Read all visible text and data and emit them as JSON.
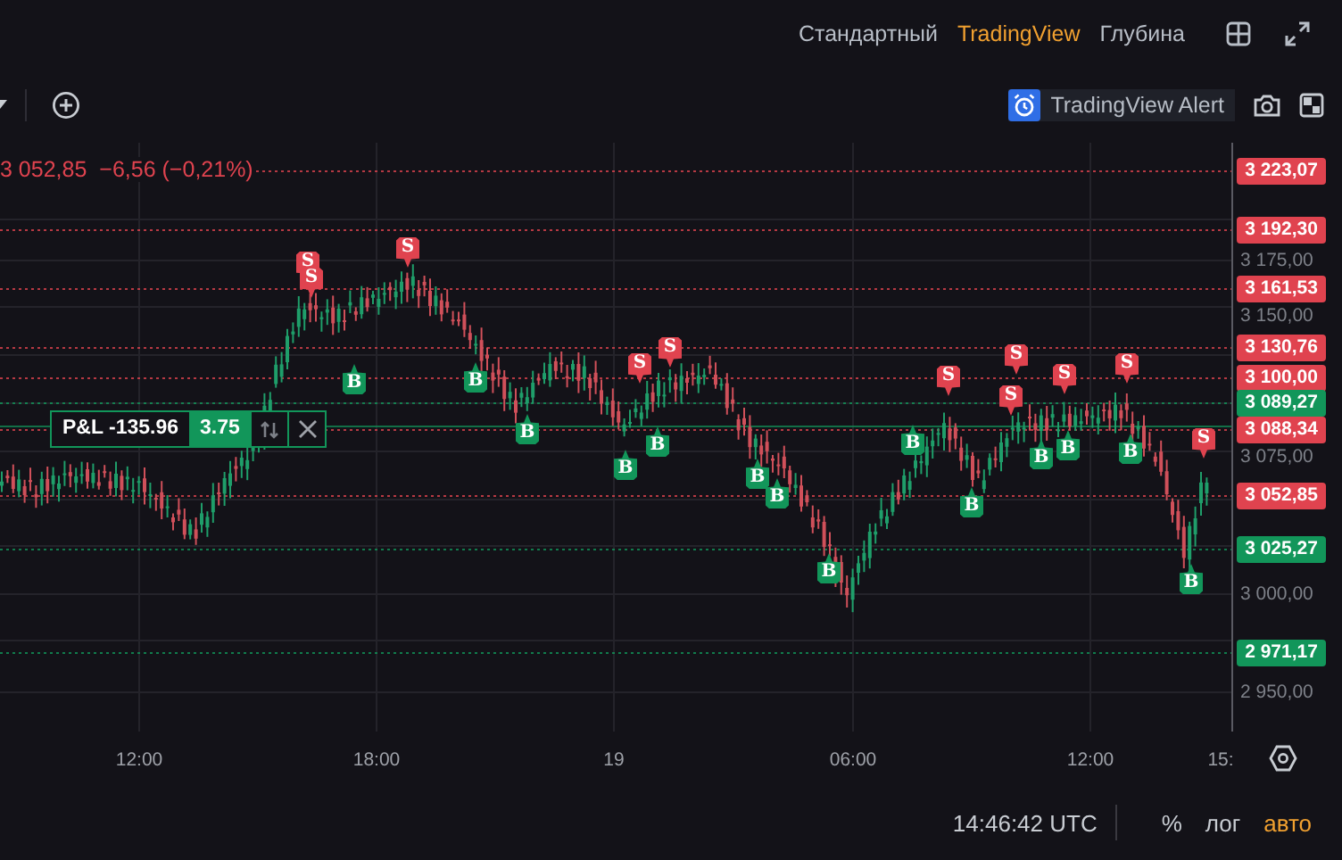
{
  "chart_types": [
    {
      "label": "Стандартный",
      "selected": false
    },
    {
      "label": "TradingView",
      "selected": true
    },
    {
      "label": "Глубина",
      "selected": false
    }
  ],
  "toolbar": {
    "alert_button": "TradingView Alert"
  },
  "legend": {
    "price": "3 052,85",
    "change": "−6,56 (−0,21%)"
  },
  "price_axis": {
    "ticks": [
      "3 175,00",
      "3 150,00",
      "3 075,00",
      "3 000,00",
      "2 950,00"
    ],
    "price_lines": [
      {
        "label": "3 223,07",
        "color": "#e0434f"
      },
      {
        "label": "3 192,30",
        "color": "#e0434f"
      },
      {
        "label": "3 161,53",
        "color": "#e0434f"
      },
      {
        "label": "3 130,76",
        "color": "#e0434f"
      },
      {
        "label": "3 100,00",
        "color": "#e0434f"
      },
      {
        "label": "3 089,27",
        "color": "#12965a"
      },
      {
        "label": "3 088,34",
        "color": "#e0434f"
      },
      {
        "label": "3 052,85",
        "color": "#e0434f"
      },
      {
        "label": "3 025,27",
        "color": "#12965a"
      },
      {
        "label": "2 971,17",
        "color": "#12965a"
      }
    ]
  },
  "time_axis": {
    "labels": [
      "12:00",
      "18:00",
      "19",
      "06:00",
      "12:00",
      "15:"
    ]
  },
  "position": {
    "pnl": "P&L -135.96",
    "quantity": "3.75"
  },
  "trade_markers": [
    {
      "kind": "sell",
      "label": "S"
    },
    {
      "kind": "sell",
      "label": "S"
    },
    {
      "kind": "sell",
      "label": "S"
    },
    {
      "kind": "sell",
      "label": "S"
    },
    {
      "kind": "sell",
      "label": "S"
    },
    {
      "kind": "sell",
      "label": "S"
    },
    {
      "kind": "sell",
      "label": "S"
    },
    {
      "kind": "sell",
      "label": "S"
    },
    {
      "kind": "sell",
      "label": "S"
    },
    {
      "kind": "sell",
      "label": "S"
    },
    {
      "kind": "sell",
      "label": "S"
    },
    {
      "kind": "buy",
      "label": "B"
    },
    {
      "kind": "buy",
      "label": "B"
    },
    {
      "kind": "buy",
      "label": "B"
    },
    {
      "kind": "buy",
      "label": "B"
    },
    {
      "kind": "buy",
      "label": "B"
    },
    {
      "kind": "buy",
      "label": "B"
    },
    {
      "kind": "buy",
      "label": "B"
    },
    {
      "kind": "buy",
      "label": "B"
    },
    {
      "kind": "buy",
      "label": "B"
    },
    {
      "kind": "buy",
      "label": "B"
    },
    {
      "kind": "buy",
      "label": "B"
    },
    {
      "kind": "buy",
      "label": "B"
    },
    {
      "kind": "buy",
      "label": "B"
    },
    {
      "kind": "buy",
      "label": "B"
    }
  ],
  "footer": {
    "time": "14:46:42 UTC",
    "percent": "%",
    "log": "лог",
    "auto": {
      "label": "авто",
      "on": true
    }
  }
}
